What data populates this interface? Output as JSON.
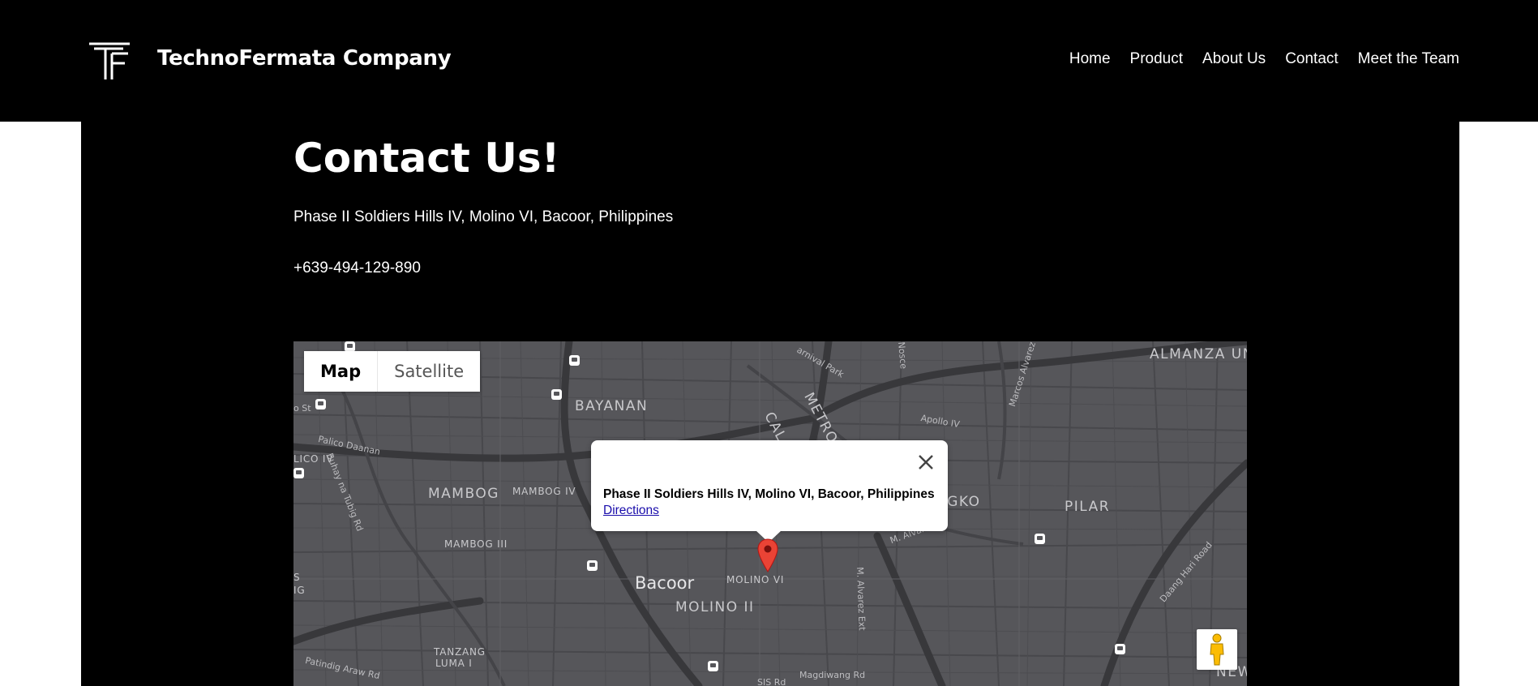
{
  "header": {
    "brand": "TechnoFermata Company",
    "logo_icon": "tf-logo-icon",
    "nav": [
      "Home",
      "Product",
      "About Us",
      "Contact",
      "Meet the Team"
    ]
  },
  "contact": {
    "title": "Contact Us!",
    "address": "Phase II Soldiers Hills IV, Molino VI, Bacoor, Philippines",
    "phone": "+639-494-129-890"
  },
  "map": {
    "type_buttons": {
      "map": "Map",
      "satellite": "Satellite"
    },
    "selected_type": "Map",
    "infowindow": {
      "title": "Phase II Soldiers Hills IV, Molino VI, Bacoor, Philippines",
      "link": "Directions"
    },
    "labels": {
      "almanza": "ALMANZA UN",
      "bayanan": "BAYANAN",
      "metro": "METRO MA",
      "cal": "CAL",
      "mambog": "MAMBOG",
      "mambog_iv": "MAMBOG IV",
      "mambog_iii": "MAMBOG III",
      "ngko": "NGKO",
      "pilar": "PILAR",
      "bacoor": "Bacoor",
      "molino_vi": "MOLINO VI",
      "molino_ii": "MOLINO II",
      "tanzang": "TANZANG",
      "luma": "LUMA I",
      "new": "NEW",
      "lico": "LICO IV",
      "palico": "Palico Daanan",
      "buhay": "Buhay na Tubig Rd",
      "carnival": "arnival Park",
      "nosce": "Nosce",
      "marcos": "Marcos Alvarez",
      "apollo": "Apollo IV",
      "malvarez": "M. Alvarez",
      "malvarez_ext": "M. Alvarez Ext",
      "daang_hari": "Daang Hari Road",
      "magdiwang": "Magdiwang Rd",
      "patindig": "Patindig Araw Rd",
      "sis": "SIS Rd",
      "st": "o St",
      "ig": "IG",
      "s": "S"
    },
    "colors": {
      "land": "#56565a",
      "roads": "#3b3b3e",
      "major_roads": "#333336"
    }
  }
}
